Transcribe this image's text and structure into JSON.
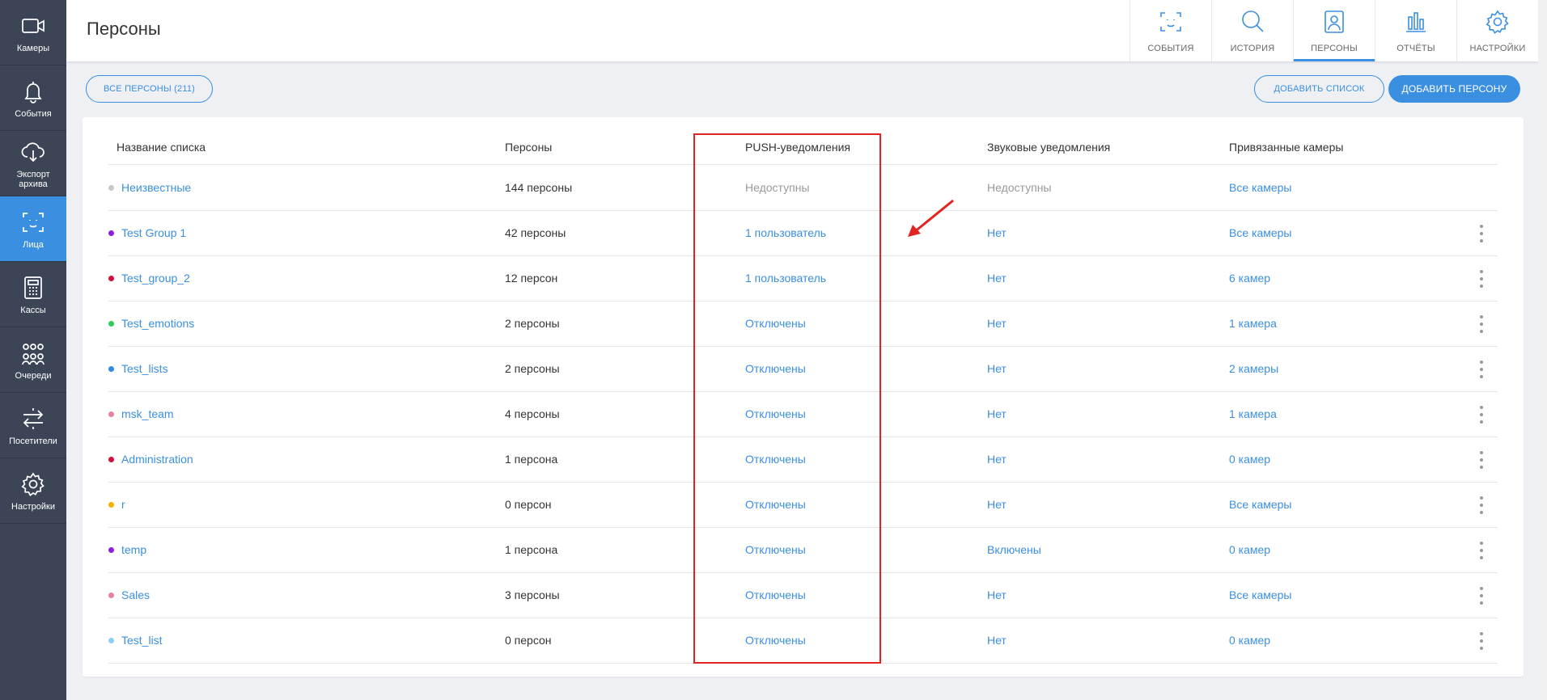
{
  "sidebar": {
    "items": [
      {
        "label": "Камеры",
        "icon": "video-camera-icon",
        "active": false
      },
      {
        "label": "События",
        "icon": "bell-icon",
        "active": false
      },
      {
        "label": "Экспорт архива",
        "icon": "cloud-download-icon",
        "active": false
      },
      {
        "label": "Лица",
        "icon": "face-frame-icon",
        "active": true
      },
      {
        "label": "Кассы",
        "icon": "cash-register-icon",
        "active": false
      },
      {
        "label": "Очереди",
        "icon": "queue-people-icon",
        "active": false
      },
      {
        "label": "Посетители",
        "icon": "transfer-arrows-icon",
        "active": false
      },
      {
        "label": "Настройки",
        "icon": "gear-icon",
        "active": false
      }
    ]
  },
  "header": {
    "title": "Персоны",
    "tabs": [
      {
        "label": "СОБЫТИЯ",
        "icon": "face-scan-icon",
        "active": false
      },
      {
        "label": "ИСТОРИЯ",
        "icon": "search-icon",
        "active": false
      },
      {
        "label": "ПЕРСОНЫ",
        "icon": "person-card-icon",
        "active": true
      },
      {
        "label": "ОТЧЁТЫ",
        "icon": "bar-chart-icon",
        "active": false
      },
      {
        "label": "НАСТРОЙКИ",
        "icon": "gear-icon",
        "active": false
      }
    ]
  },
  "toolbar": {
    "all_persons": "ВСЕ ПЕРСОНЫ (211)",
    "add_list": "ДОБАВИТЬ СПИСОК",
    "add_person": "ДОБАВИТЬ ПЕРСОНУ"
  },
  "table": {
    "columns": {
      "name": "Название списка",
      "persons": "Персоны",
      "push": "PUSH-уведомления",
      "sound": "Звуковые уведомления",
      "cameras": "Привязанные камеры"
    },
    "rows": [
      {
        "name": "Неизвестные",
        "color": "#c8c8c8",
        "persons": "144 персоны",
        "push": "Недоступны",
        "sound": "Недоступны",
        "cameras": "Все камеры",
        "disabled": true
      },
      {
        "name": "Test Group 1",
        "color": "#8a1fe0",
        "persons": "42 персоны",
        "push": "1 пользователь",
        "sound": "Нет",
        "cameras": "Все камеры",
        "disabled": false
      },
      {
        "name": "Test_group_2",
        "color": "#d0103a",
        "persons": "12 персон",
        "push": "1 пользователь",
        "sound": "Нет",
        "cameras": "6 камер",
        "disabled": false
      },
      {
        "name": "Test_emotions",
        "color": "#2ecc5a",
        "persons": "2 персоны",
        "push": "Отключены",
        "sound": "Нет",
        "cameras": "1 камера",
        "disabled": false
      },
      {
        "name": "Test_lists",
        "color": "#2f8ae0",
        "persons": "2 персоны",
        "push": "Отключены",
        "sound": "Нет",
        "cameras": "2 камеры",
        "disabled": false
      },
      {
        "name": "msk_team",
        "color": "#e87fa8",
        "persons": "4 персоны",
        "push": "Отключены",
        "sound": "Нет",
        "cameras": "1 камера",
        "disabled": false
      },
      {
        "name": "Administration",
        "color": "#d0103a",
        "persons": "1 персона",
        "push": "Отключены",
        "sound": "Нет",
        "cameras": "0 камер",
        "disabled": false
      },
      {
        "name": "r",
        "color": "#f0b400",
        "persons": "0 персон",
        "push": "Отключены",
        "sound": "Нет",
        "cameras": "Все камеры",
        "disabled": false
      },
      {
        "name": "temp",
        "color": "#8a1fe0",
        "persons": "1 персона",
        "push": "Отключены",
        "sound": "Включены",
        "cameras": "0 камер",
        "disabled": false
      },
      {
        "name": "Sales",
        "color": "#e87fa8",
        "persons": "3 персоны",
        "push": "Отключены",
        "sound": "Нет",
        "cameras": "Все камеры",
        "disabled": false
      },
      {
        "name": "Test_list",
        "color": "#8fcdf5",
        "persons": "0 персон",
        "push": "Отключены",
        "sound": "Нет",
        "cameras": "0 камер",
        "disabled": false
      }
    ]
  },
  "colors": {
    "accent": "#3b8fe0",
    "sidebar_bg": "#3c4556",
    "annotation": "#e32222"
  }
}
